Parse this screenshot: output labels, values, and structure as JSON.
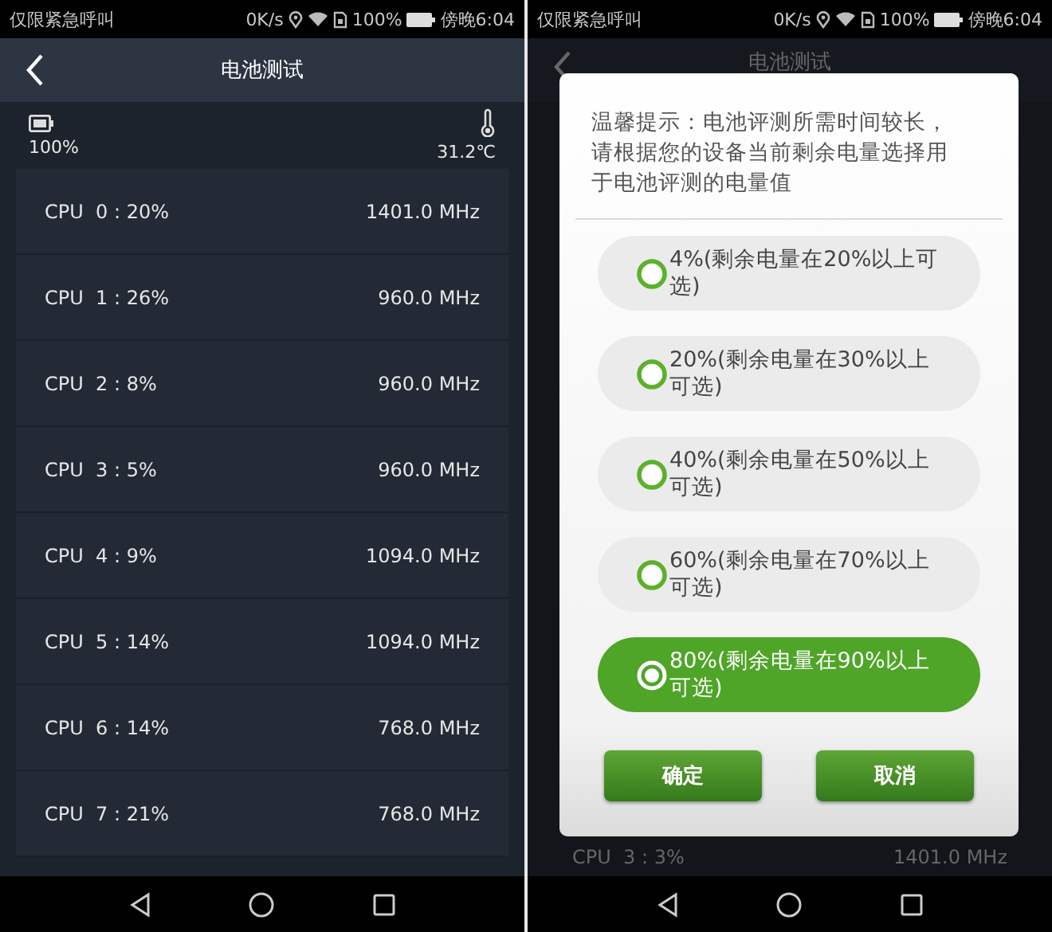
{
  "left": {
    "status_bar": {
      "carrier": "仅限紧急呼叫",
      "speed": "0K/s",
      "battery": "100%",
      "time": "傍晚6:04"
    },
    "header": {
      "title": "电池测试"
    },
    "battery_level": "100%",
    "temperature": "31.2℃",
    "cpus": [
      {
        "label": "CPU  0 : 20%",
        "freq": "1401.0 MHz"
      },
      {
        "label": "CPU  1 : 26%",
        "freq": "960.0 MHz"
      },
      {
        "label": "CPU  2 : 8%",
        "freq": "960.0 MHz"
      },
      {
        "label": "CPU  3 : 5%",
        "freq": "960.0 MHz"
      },
      {
        "label": "CPU  4 : 9%",
        "freq": "1094.0 MHz"
      },
      {
        "label": "CPU  5 : 14%",
        "freq": "1094.0 MHz"
      },
      {
        "label": "CPU  6 : 14%",
        "freq": "768.0 MHz"
      },
      {
        "label": "CPU  7 : 21%",
        "freq": "768.0 MHz"
      }
    ]
  },
  "right": {
    "status_bar": {
      "carrier": "仅限紧急呼叫",
      "speed": "0K/s",
      "battery": "100%",
      "time": "傍晚6:04"
    },
    "header": {
      "title": "电池测试"
    },
    "cpus": [
      {
        "label": "CPU  3 : 3%",
        "freq": "1401.0 MHz"
      }
    ],
    "dialog": {
      "message": "温馨提示：电池评测所需时间较长，请根据您的设备当前剩余电量选择用于电池评测的电量值",
      "options": [
        {
          "label": "4%(剩余电量在20%以上可选)",
          "selected": false
        },
        {
          "label": "20%(剩余电量在30%以上可选)",
          "selected": false
        },
        {
          "label": "40%(剩余电量在50%以上可选)",
          "selected": false
        },
        {
          "label": "60%(剩余电量在70%以上可选)",
          "selected": false
        },
        {
          "label": "80%(剩余电量在90%以上可选)",
          "selected": true
        }
      ],
      "buttons": [
        "确定",
        "取消"
      ]
    }
  }
}
